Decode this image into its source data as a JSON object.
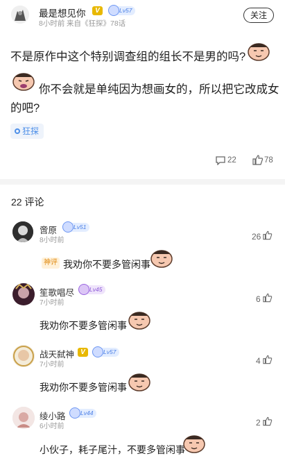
{
  "post": {
    "author": "最是想见你",
    "level": "Lv57",
    "time": "8小时前",
    "source": "来自《狂探》78话",
    "follow_label": "关注",
    "line1": "不是原作中这个特别调查组的组长不是男的吗?",
    "line2": "你不会就是单纯因为想画女的，所以把它改成女",
    "line3": "的吧?",
    "tag": "狂探",
    "comment_count": "22",
    "like_count": "78"
  },
  "comments_header": "22 评论",
  "comments": [
    {
      "name": "啻原",
      "level": "Lv51",
      "time": "8小时前",
      "likes": "26",
      "badge": "神评",
      "text": "我劝你不要多管闲事"
    },
    {
      "name": "笙歌唱尽",
      "level": "Lv45",
      "time": "7小时前",
      "likes": "6",
      "text": "我劝你不要多管闲事"
    },
    {
      "name": "战天弑神",
      "level": "Lv57",
      "time": "7小时前",
      "likes": "4",
      "text": "我劝你不要多管闲事"
    },
    {
      "name": "绫小路",
      "level": "Lv44",
      "time": "6小时前",
      "likes": "2",
      "text": "小伙子，耗子尾汁，不要多管闲事"
    }
  ],
  "colors": {
    "accent": "#4d8fe8",
    "vip_badge": "#e8b800",
    "shenping": "#e08a12"
  },
  "icons": [
    "comment-icon",
    "thumb-up-icon",
    "sticker-emoji"
  ]
}
